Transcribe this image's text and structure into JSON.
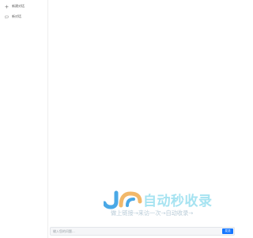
{
  "sidebar": {
    "items": [
      {
        "label": "新建对话",
        "icon": "plus-icon"
      },
      {
        "label": "新对话",
        "icon": "chat-bubble-icon"
      }
    ]
  },
  "watermark": {
    "title": "自动秒收录",
    "subtitle": "做上链接→来访一次→自动收录→",
    "logo_text": "JO",
    "colors": {
      "primary": "#4aa8e6",
      "secondary": "#f2b86a"
    }
  },
  "input": {
    "placeholder": "输入您的问题...",
    "value": ""
  },
  "send_button": {
    "label": "发送",
    "color": "#1677ff"
  }
}
